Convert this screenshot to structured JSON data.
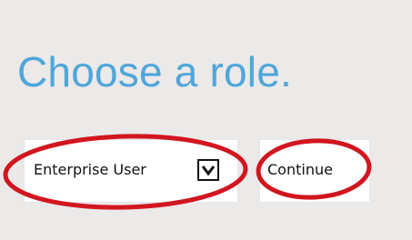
{
  "heading": "Choose a role.",
  "role_select": {
    "selected": "Enterprise User",
    "icon": "chevron-down-icon"
  },
  "continue_button": {
    "label": "Continue"
  },
  "colors": {
    "background": "#ece9e9",
    "heading": "#4fa6d9",
    "annotation": "#d11620"
  }
}
